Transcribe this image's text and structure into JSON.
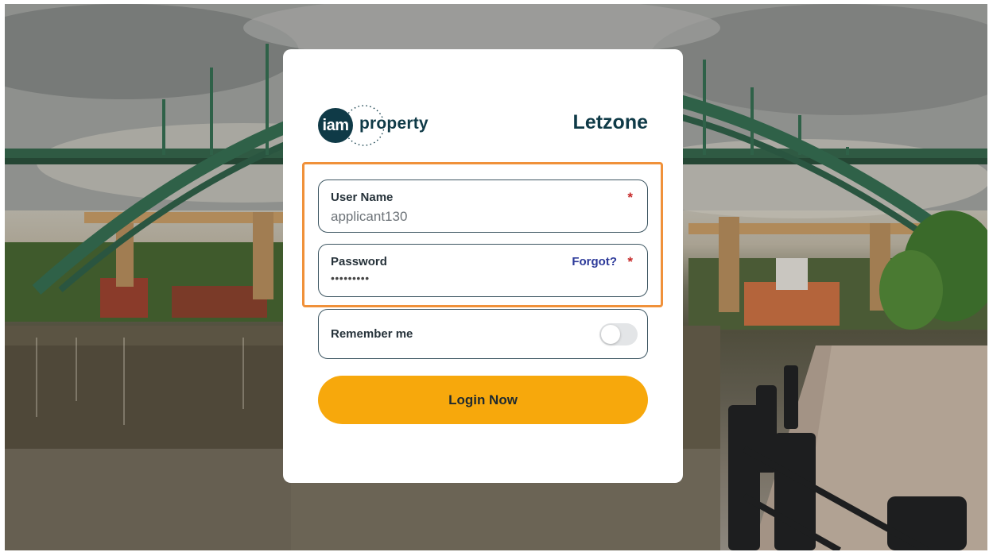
{
  "brand": {
    "logo_badge": "iam",
    "logo_word": "property",
    "app_name": "Letzone"
  },
  "form": {
    "username": {
      "label": "User Name",
      "value": "applicant130",
      "required_mark": "*"
    },
    "password": {
      "label": "Password",
      "value": "•••••••••",
      "forgot_label": "Forgot?",
      "required_mark": "*"
    },
    "remember": {
      "label": "Remember me",
      "checked": false
    },
    "submit_label": "Login Now"
  },
  "colors": {
    "accent_button": "#f7a80c",
    "highlight_border": "#f0913a",
    "brand_dark": "#0f3a47",
    "forgot_link": "#2d3a9a",
    "required": "#c62828"
  },
  "icons": [
    "iam-property-logo",
    "toggle-switch"
  ]
}
